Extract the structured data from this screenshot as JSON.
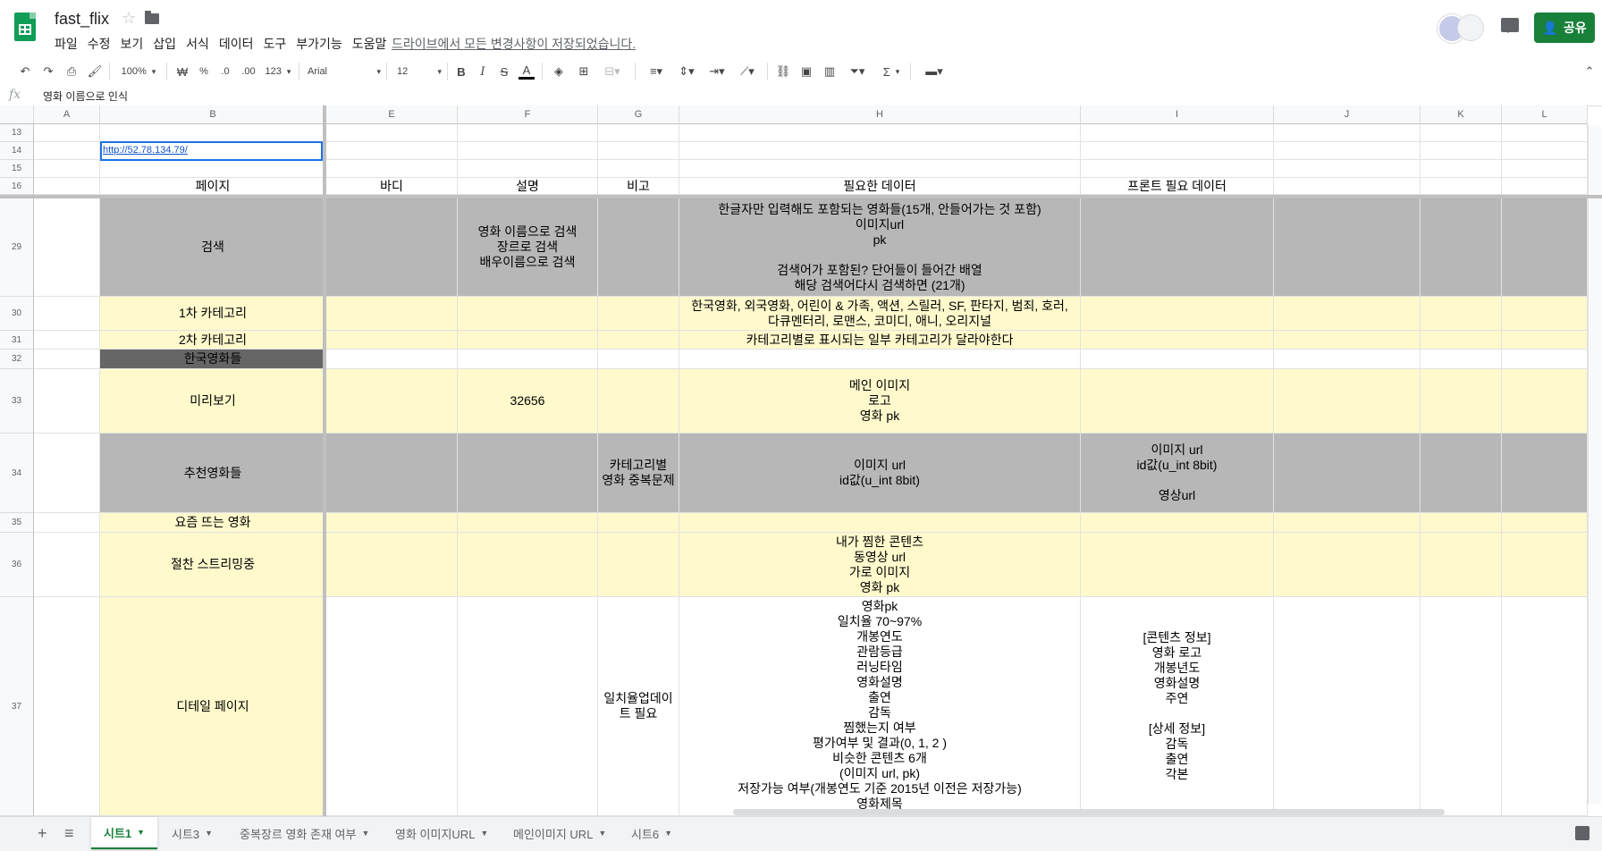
{
  "app": {
    "doc_title": "fast_flix",
    "menu": [
      "파일",
      "수정",
      "보기",
      "삽입",
      "서식",
      "데이터",
      "도구",
      "부가기능",
      "도움말"
    ],
    "save_status": "드라이브에서 모든 변경사항이 저장되었습니다.",
    "share_label": "공유",
    "icons": [
      "sheets-logo-icon",
      "star-icon",
      "folder-icon",
      "avatar",
      "comments-icon",
      "share-person-icon"
    ],
    "colors": {
      "accent": "#188038",
      "gray_fill": "#b7b7b7",
      "yellow_fill": "#fff9cc",
      "dark_fill": "#666666"
    }
  },
  "toolbar": {
    "zoom": "100%",
    "currency": "₩",
    "percent": "%",
    "dec_less": ".0",
    "dec_more": ".00",
    "format_more": "123",
    "font": "Arial",
    "font_size": "12",
    "bold": "B",
    "italic": "I",
    "strike": "S",
    "text_color": "A",
    "sum": "Σ"
  },
  "formula_bar": {
    "fx": "fx",
    "content": "영화 이름으로 인식"
  },
  "columns": [
    "A",
    "B",
    "E",
    "F",
    "G",
    "H",
    "I",
    "J",
    "K",
    "L"
  ],
  "rows": [
    {
      "num": "13",
      "cells": [
        "",
        "",
        "",
        "",
        "",
        "",
        "",
        "",
        "",
        ""
      ]
    },
    {
      "num": "14",
      "cells": [
        "",
        "http://52.78.134.79/",
        "",
        "",
        "",
        "",
        "",
        "",
        "",
        ""
      ]
    },
    {
      "num": "15",
      "cells": [
        "",
        "",
        "",
        "",
        "",
        "",
        "",
        "",
        "",
        ""
      ]
    },
    {
      "num": "16",
      "cells": [
        "",
        "페이지",
        "바디",
        "설명",
        "비고",
        "필요한 데이터",
        "프론트 필요 데이터",
        "",
        "",
        ""
      ]
    },
    {
      "num": "29",
      "cells": [
        "",
        "검색",
        "",
        "영화 이름으로 검색\n장르로 검색\n배우이름으로 검색",
        "",
        "한글자만 입력해도 포함되는 영화들(15개, 안들어가는 것 포함)\n이미지url\npk\n\n검색어가 포함된? 단어들이 들어간 배열\n해당 검색어다시 검색하면 (21개)",
        "",
        "",
        "",
        ""
      ]
    },
    {
      "num": "30",
      "cells": [
        "",
        "1차 카테고리",
        "",
        "",
        "",
        "한국영화, 외국영화, 어린이 & 가족, 액션, 스릴러, SF, 판타지, 범죄, 호러,\n다큐멘터리, 로맨스, 코미디, 애니, 오리지널",
        "",
        "",
        "",
        ""
      ]
    },
    {
      "num": "31",
      "cells": [
        "",
        "2차 카테고리",
        "",
        "",
        "",
        "카테고리별로 표시되는 일부 카테고리가 달라야한다",
        "",
        "",
        "",
        ""
      ]
    },
    {
      "num": "32",
      "cells": [
        "",
        "한국영화들",
        "",
        "",
        "",
        "",
        "",
        "",
        "",
        ""
      ]
    },
    {
      "num": "33",
      "cells": [
        "",
        "미리보기",
        "",
        "32656",
        "",
        "메인 이미지\n로고\n영화 pk",
        "",
        "",
        "",
        ""
      ]
    },
    {
      "num": "34",
      "cells": [
        "",
        "추천영화들",
        "",
        "",
        "카테고리별\n영화 중복문제",
        "이미지 url\nid값(u_int 8bit)",
        "이미지 url\nid값(u_int 8bit)\n\n영상url",
        "",
        "",
        ""
      ]
    },
    {
      "num": "35",
      "cells": [
        "",
        "요즘 뜨는 영화",
        "",
        "",
        "",
        "",
        "",
        "",
        "",
        ""
      ]
    },
    {
      "num": "36",
      "cells": [
        "",
        "절찬 스트리밍중",
        "",
        "",
        "",
        "내가 찜한 콘텐츠\n동영상 url\n가로 이미지\n영화 pk",
        "",
        "",
        "",
        ""
      ]
    },
    {
      "num": "37",
      "cells": [
        "",
        "디테일 페이지",
        "",
        "",
        "일치율업데이\n트 필요",
        "영화pk\n일치율 70~97%\n개봉연도\n관람등급\n러닝타임\n영화설명\n출연\n감독\n찜했는지 여부\n평가여부 및 결과(0, 1, 2 )\n비슷한 콘텐츠 6개\n(이미지 url, pk)\n저장가능 여부(개봉연도 기준 2015년 이전은 저장가능)\n영화제목",
        "[콘텐츠 정보]\n영화 로고\n개봉년도\n영화설명\n주연\n\n[상세 정보]\n감독\n출연\n각본",
        "",
        "",
        ""
      ]
    }
  ],
  "sheet_tabs": [
    "시트1",
    "시트3",
    "중복장르 영화 존재 여부",
    "영화 이미지URL",
    "메인이미지 URL",
    "시트6"
  ],
  "bottom": {
    "add": "+",
    "list": "≡"
  }
}
